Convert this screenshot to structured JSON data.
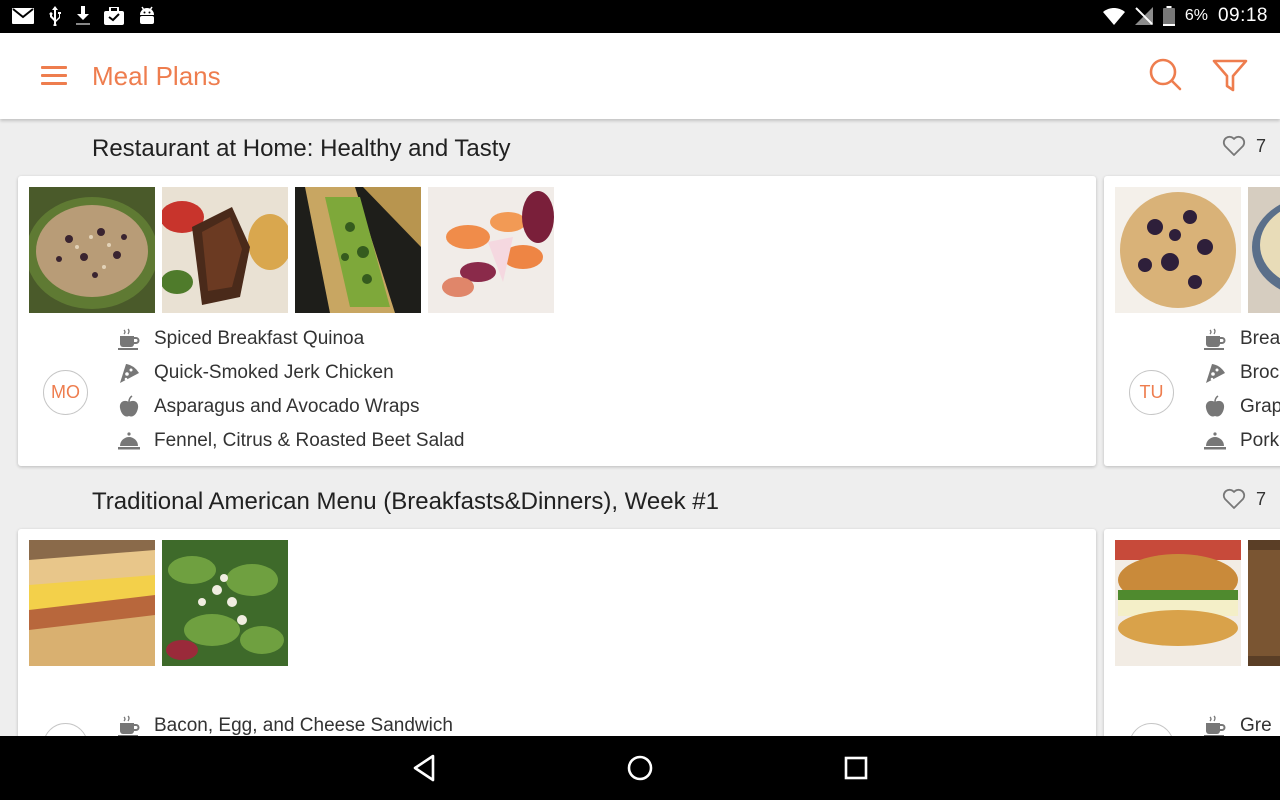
{
  "status_bar": {
    "battery_percent": "6%",
    "time": "09:18",
    "left_icons": [
      "mail-icon",
      "usb-icon",
      "download-icon",
      "briefcase-icon",
      "android-icon"
    ],
    "right_icons": [
      "wifi-icon",
      "no-signal-icon",
      "battery-icon"
    ]
  },
  "app_bar": {
    "title": "Meal Plans",
    "accent": "#ee7d4e",
    "actions": [
      "menu-icon",
      "search-icon",
      "filter-icon"
    ]
  },
  "plans": [
    {
      "title": "Restaurant at Home: Healthy and Tasty",
      "likes": "7",
      "day": "MO",
      "photos": [
        "quinoa-photo",
        "jerk-chicken-photo",
        "wrap-photo",
        "beet-salad-photo"
      ],
      "meals": [
        {
          "icon": "coffee-cup-icon",
          "name": "Spiced Breakfast Quinoa"
        },
        {
          "icon": "pizza-slice-icon",
          "name": "Quick-Smoked Jerk Chicken"
        },
        {
          "icon": "apple-icon",
          "name": "Asparagus and Avocado Wraps"
        },
        {
          "icon": "cloche-icon",
          "name": "Fennel, Citrus & Roasted Beet Salad"
        }
      ],
      "next_day": {
        "day": "TU",
        "meals": [
          {
            "icon": "coffee-cup-icon",
            "name": "Brea"
          },
          {
            "icon": "pizza-slice-icon",
            "name": "Broc"
          },
          {
            "icon": "apple-icon",
            "name": "Grap"
          },
          {
            "icon": "cloche-icon",
            "name": "Pork"
          }
        ]
      }
    },
    {
      "title": "Traditional American Menu (Breakfasts&Dinners), Week #1",
      "likes": "7",
      "day": "",
      "photos": [
        "sandwich-photo",
        "green-salad-photo"
      ],
      "meals": [
        {
          "icon": "coffee-cup-icon",
          "name": "Bacon, Egg, and Cheese Sandwich"
        }
      ],
      "next_day": {
        "day": "",
        "meals": [
          {
            "icon": "coffee-cup-icon",
            "name": "Gre"
          }
        ]
      }
    }
  ],
  "nav_bar": {
    "buttons": [
      "back-icon",
      "home-icon",
      "recents-icon"
    ]
  }
}
